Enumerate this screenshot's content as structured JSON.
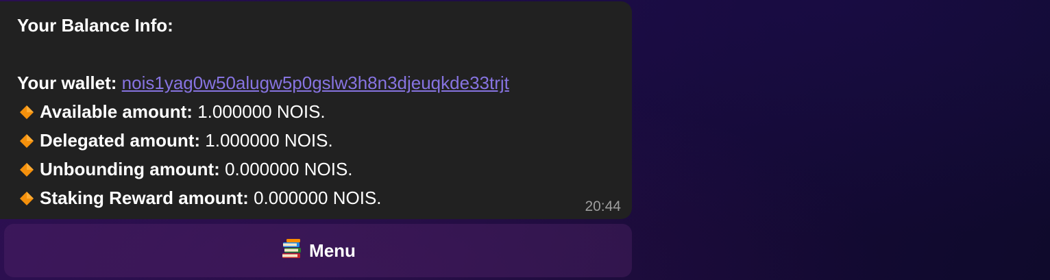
{
  "message": {
    "title": "Your Balance Info:",
    "wallet_label": "Your wallet:",
    "wallet_address": "nois1yag0w50alugw5p0gslw3h8n3djeuqkde33trjt",
    "rows": [
      {
        "label": "Available amount:",
        "value": "1.000000 NOIS."
      },
      {
        "label": "Delegated amount:",
        "value": "1.000000 NOIS."
      },
      {
        "label": "Unbounding amount:",
        "value": "0.000000 NOIS."
      },
      {
        "label": "Staking Reward amount:",
        "value": "0.000000 NOIS."
      }
    ],
    "row_icon": "orange-diamond-icon",
    "time": "20:44"
  },
  "keyboard": {
    "menu_label": "Menu",
    "menu_icon": "books-icon"
  },
  "colors": {
    "bubble": "#212121",
    "link": "#8774e1",
    "diamond": "#f4900c",
    "timestamp": "#9e9e9e"
  }
}
